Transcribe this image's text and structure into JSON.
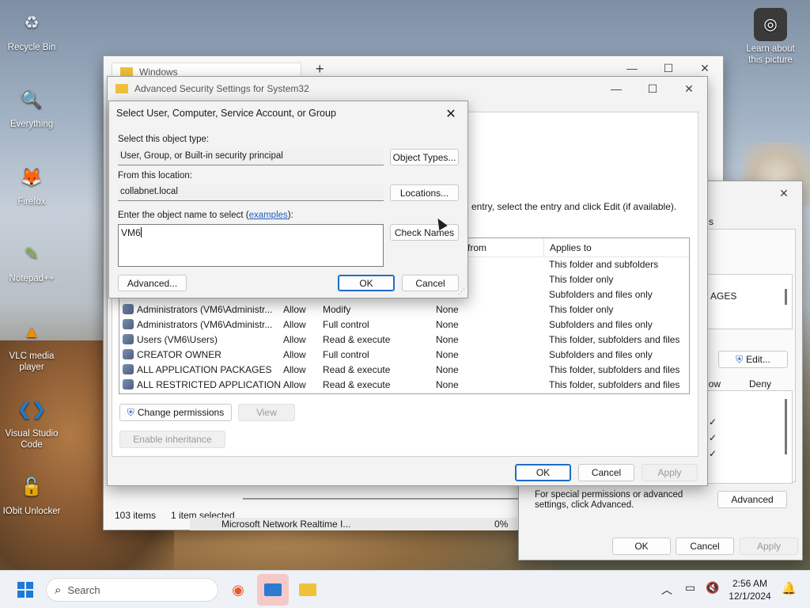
{
  "desktop": {
    "icons": [
      {
        "label": "Recycle Bin",
        "glyph": "♻",
        "color": "#dfe8f0"
      },
      {
        "label": "Everything",
        "glyph": "🔍",
        "color": "#f08c1e"
      },
      {
        "label": "Firefox",
        "glyph": "🦊",
        "color": "#e8592a"
      },
      {
        "label": "Notepad++",
        "glyph": "✎",
        "color": "#8fc45a"
      },
      {
        "label": "VLC media player",
        "glyph": "▲",
        "color": "#f28a00"
      },
      {
        "label": "Visual Studio Code",
        "glyph": "❮❯",
        "color": "#1f7cc9"
      },
      {
        "label": "IObit Unlocker",
        "glyph": "🔓",
        "color": "#3aa0dd"
      }
    ],
    "learn_label": "Learn about this picture"
  },
  "explorer": {
    "tab_title": "Windows",
    "new_tab": "+",
    "status_items": "103 items",
    "status_selected": "1 item selected",
    "bg_row": "Microsoft Network Realtime I...",
    "bg_pct": "0%"
  },
  "adv_security": {
    "title": "Advanced Security Settings for System32",
    "instruction": "entry, select the entry and click Edit (if available).",
    "columns": [
      "d from",
      "Applies to"
    ],
    "rows": [
      {
        "principal": "",
        "access": "",
        "perm": "",
        "inherited": "",
        "applies": "This folder and subfolders"
      },
      {
        "principal": "",
        "access": "",
        "perm": "",
        "inherited": "",
        "applies": "This folder only"
      },
      {
        "principal": "",
        "access": "",
        "perm": "",
        "inherited": "",
        "applies": "Subfolders and files only"
      },
      {
        "principal": "Administrators (VM6\\Administr...",
        "access": "Allow",
        "perm": "Modify",
        "inherited": "None",
        "applies": "This folder only"
      },
      {
        "principal": "Administrators (VM6\\Administr...",
        "access": "Allow",
        "perm": "Full control",
        "inherited": "None",
        "applies": "Subfolders and files only"
      },
      {
        "principal": "Users (VM6\\Users)",
        "access": "Allow",
        "perm": "Read & execute",
        "inherited": "None",
        "applies": "This folder, subfolders and files"
      },
      {
        "principal": "CREATOR OWNER",
        "access": "Allow",
        "perm": "Full control",
        "inherited": "None",
        "applies": "Subfolders and files only"
      },
      {
        "principal": "ALL APPLICATION PACKAGES",
        "access": "Allow",
        "perm": "Read & execute",
        "inherited": "None",
        "applies": "This folder, subfolders and files"
      },
      {
        "principal": "ALL RESTRICTED APPLICATION ...",
        "access": "Allow",
        "perm": "Read & execute",
        "inherited": "None",
        "applies": "This folder, subfolders and files"
      }
    ],
    "change_permissions": "Change permissions",
    "view": "View",
    "enable_inheritance": "Enable inheritance",
    "ok": "OK",
    "cancel": "Cancel",
    "apply": "Apply"
  },
  "properties": {
    "tab_fragment": "s",
    "list_item": "AGES",
    "edit": "Edit...",
    "col_allow": "low",
    "col_deny": "Deny",
    "checks": [
      "✓",
      "✓",
      "✓"
    ],
    "hint": "For special permissions or advanced settings, click Advanced.",
    "advanced": "Advanced",
    "ok": "OK",
    "cancel": "Cancel",
    "apply": "Apply"
  },
  "select_dialog": {
    "title": "Select User, Computer, Service Account, or Group",
    "object_type_label": "Select this object type:",
    "object_type_value": "User, Group, or Built-in security principal",
    "object_types_btn": "Object Types...",
    "location_label": "From this location:",
    "location_value": "collabnet.local",
    "locations_btn": "Locations...",
    "name_label_pre": "Enter the object name to select (",
    "name_label_link": "examples",
    "name_label_post": "):",
    "name_value": "VM6",
    "check_names_btn": "Check Names",
    "advanced_btn": "Advanced...",
    "ok_btn": "OK",
    "cancel_btn": "Cancel"
  },
  "taskbar": {
    "search_placeholder": "Search",
    "time": "2:56 AM",
    "date": "12/1/2024"
  }
}
